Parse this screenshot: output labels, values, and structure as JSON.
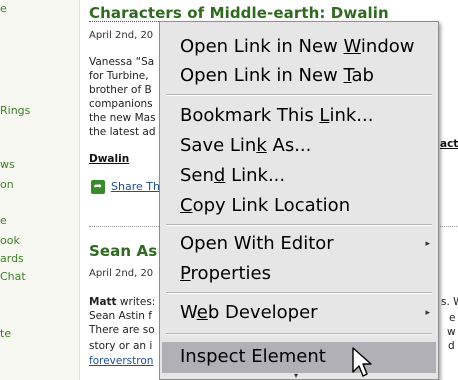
{
  "sidebar": {
    "items": [
      {
        "label": "e"
      },
      {
        "label": "Rings"
      },
      {
        "label": "ws"
      },
      {
        "label": "on"
      },
      {
        "label": "e"
      },
      {
        "label": "ook"
      },
      {
        "label": "ards"
      },
      {
        "label": "Chat"
      },
      {
        "label": "te"
      }
    ]
  },
  "articles": [
    {
      "title": "Characters of Middle-earth: Dwalin",
      "date": "April 2nd, 20",
      "lines": [
        "Vanessa “Sa",
        "for Turbine,",
        "brother of B",
        "companions",
        "the new Mas",
        "the latest ad"
      ],
      "link_label": "Dwalin",
      "right_fragment": "act",
      "share_label": "Share Th"
    },
    {
      "title": "Sean As",
      "date": "April 2nd, 20",
      "author": "Matt",
      "author_suffix": " writes:",
      "lines": [
        "Sean Astin f",
        "There are so",
        "story or an i"
      ],
      "link_label": "foreverstron",
      "right_fragments": [
        "s. W",
        "e",
        "w",
        "d"
      ]
    }
  ],
  "context_menu": {
    "items": [
      {
        "pre": "Open Link in New ",
        "u": "W",
        "post": "indow"
      },
      {
        "pre": "Open Link in New ",
        "u": "T",
        "post": "ab"
      },
      {
        "pre": "Bookmark This ",
        "u": "L",
        "post": "ink..."
      },
      {
        "pre": "Save Lin",
        "u": "k",
        "post": " As..."
      },
      {
        "pre": "Sen",
        "u": "d",
        "post": " Link..."
      },
      {
        "pre": "",
        "u": "C",
        "post": "opy Link Location"
      },
      {
        "pre": "Open With Editor",
        "u": "",
        "post": ""
      },
      {
        "pre": "",
        "u": "P",
        "post": "roperties"
      },
      {
        "pre": "W",
        "u": "e",
        "post": "b Developer"
      },
      {
        "pre": "Inspect Element",
        "u": "",
        "post": ""
      }
    ],
    "submenu_arrow": "▸",
    "scroll_arrow": "▾",
    "highlighted_item": "Inspect Element",
    "highlight_color": "#b0b0b6"
  },
  "icons": {
    "share": "share-icon",
    "cursor": "mouse-cursor-icon"
  },
  "colors": {
    "title": "#2f6a1f",
    "sidebar_link": "#3f7f2a",
    "menu_bg": "#e6e6e6"
  }
}
